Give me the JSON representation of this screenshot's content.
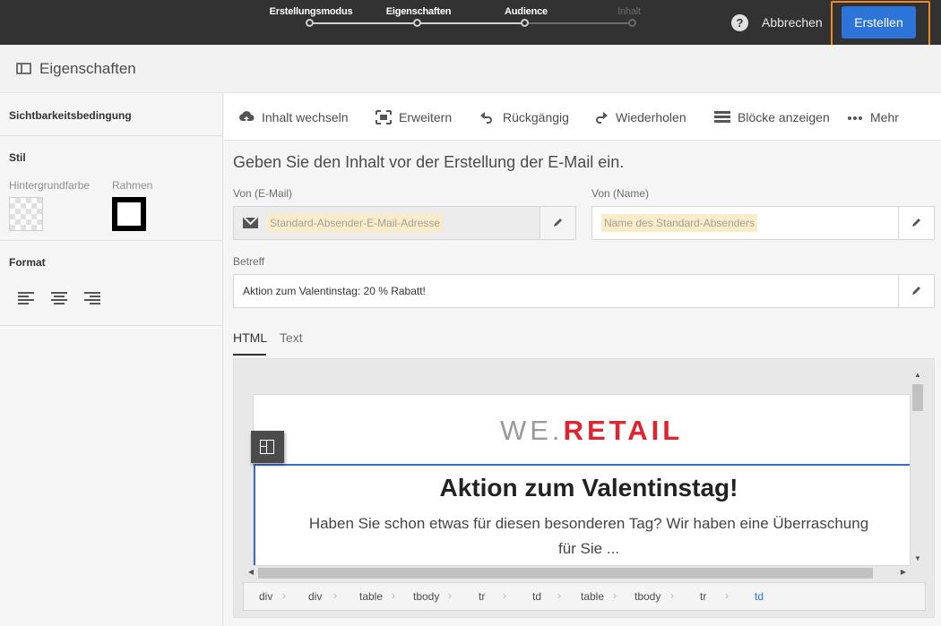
{
  "wizard": {
    "steps": [
      {
        "label": "Erstellungsmodus",
        "state": "done"
      },
      {
        "label": "Eigenschaften",
        "state": "current"
      },
      {
        "label": "Audience",
        "state": "done"
      },
      {
        "label": "Inhalt",
        "state": "pending"
      }
    ],
    "help_label": "?",
    "cancel_label": "Abbrechen",
    "create_label": "Erstellen"
  },
  "page": {
    "title": "Eigenschaften"
  },
  "sidebar": {
    "visibility_title": "Sichtbarkeitsbedingung",
    "style_title": "Stil",
    "bg_color_label": "Hintergrundfarbe",
    "border_label": "Rahmen",
    "format_title": "Format"
  },
  "toolbar": {
    "switch_content": "Inhalt wechseln",
    "expand": "Erweitern",
    "undo": "Rückgängig",
    "redo": "Wiederholen",
    "show_blocks": "Blöcke anzeigen",
    "more": "Mehr"
  },
  "form": {
    "intro": "Geben Sie den Inhalt vor der Erstellung der E-Mail ein.",
    "from_email_label": "Von (E-Mail)",
    "from_email_placeholder": "Standard-Absender-E-Mail-Adresse",
    "from_name_label": "Von (Name)",
    "from_name_placeholder": "Name des Standard-Absenders",
    "subject_label": "Betreff",
    "subject_value": "Aktion zum Valentinstag: 20 % Rabatt!"
  },
  "tabs": {
    "html": "HTML",
    "text": "Text"
  },
  "email": {
    "logo_left": "WE.",
    "logo_right": "RETAIL",
    "headline": "Aktion zum Valentinstag!",
    "subline": "Haben Sie schon etwas für diesen besonderen Tag? Wir haben eine Überraschung für Sie ..."
  },
  "breadcrumb": [
    "div",
    "div",
    "table",
    "tbody",
    "tr",
    "td",
    "table",
    "tbody",
    "tr",
    "td"
  ],
  "colors": {
    "accent": "#2d74d9",
    "focus": "#f08a24",
    "topbar": "#323232",
    "logo_red": "#e0242f"
  }
}
